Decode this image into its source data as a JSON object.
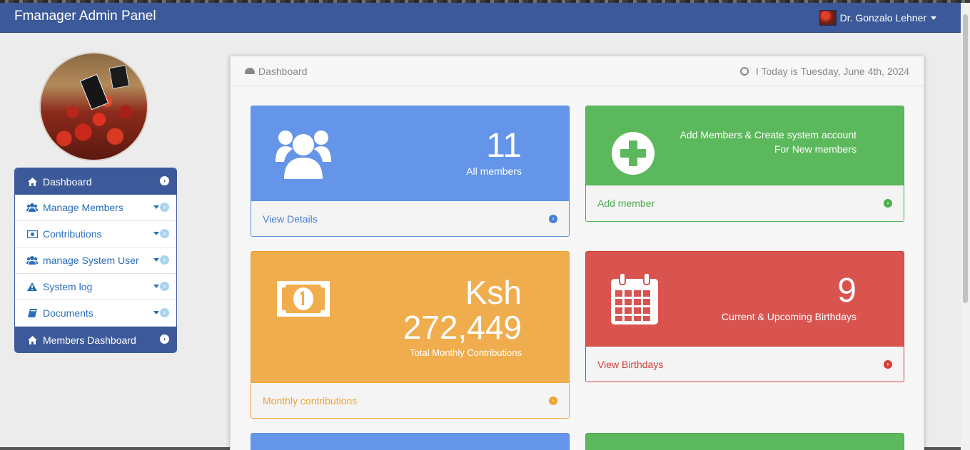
{
  "app": {
    "title": "Fmanager Admin Panel",
    "user_name": "Dr. Gonzalo Lehner"
  },
  "sidebar": {
    "items": [
      {
        "label": "Dashboard",
        "icon": "home-icon",
        "active": true
      },
      {
        "label": "Manage Members",
        "icon": "users-icon",
        "active": false
      },
      {
        "label": "Contributions",
        "icon": "money-icon",
        "active": false
      },
      {
        "label": "manage System User",
        "icon": "users-icon",
        "active": false
      },
      {
        "label": "System log",
        "icon": "warning-icon",
        "active": false
      },
      {
        "label": "Documents",
        "icon": "book-icon",
        "active": false
      },
      {
        "label": "Members Dashboard",
        "icon": "home-icon",
        "active": true
      }
    ]
  },
  "panel": {
    "heading": "Dashboard",
    "date_text": "I Today is Tuesday, June 4th, 2024"
  },
  "cards": {
    "members": {
      "count": "11",
      "label": "All members",
      "link": "View Details",
      "color": "#6495e8"
    },
    "add": {
      "line1": "Add Members & Create system account",
      "line2": "For New members",
      "link": "Add member",
      "color": "#5cb85c"
    },
    "contributions": {
      "currency": "Ksh",
      "amount": "272,449",
      "label": "Total Monthly Contributions",
      "link": "Monthly contributions",
      "color": "#f0ad4e"
    },
    "birthdays": {
      "count": "9",
      "label": "Current & Upcoming Birthdays",
      "link": "View Birthdays",
      "color": "#d9534f"
    }
  }
}
